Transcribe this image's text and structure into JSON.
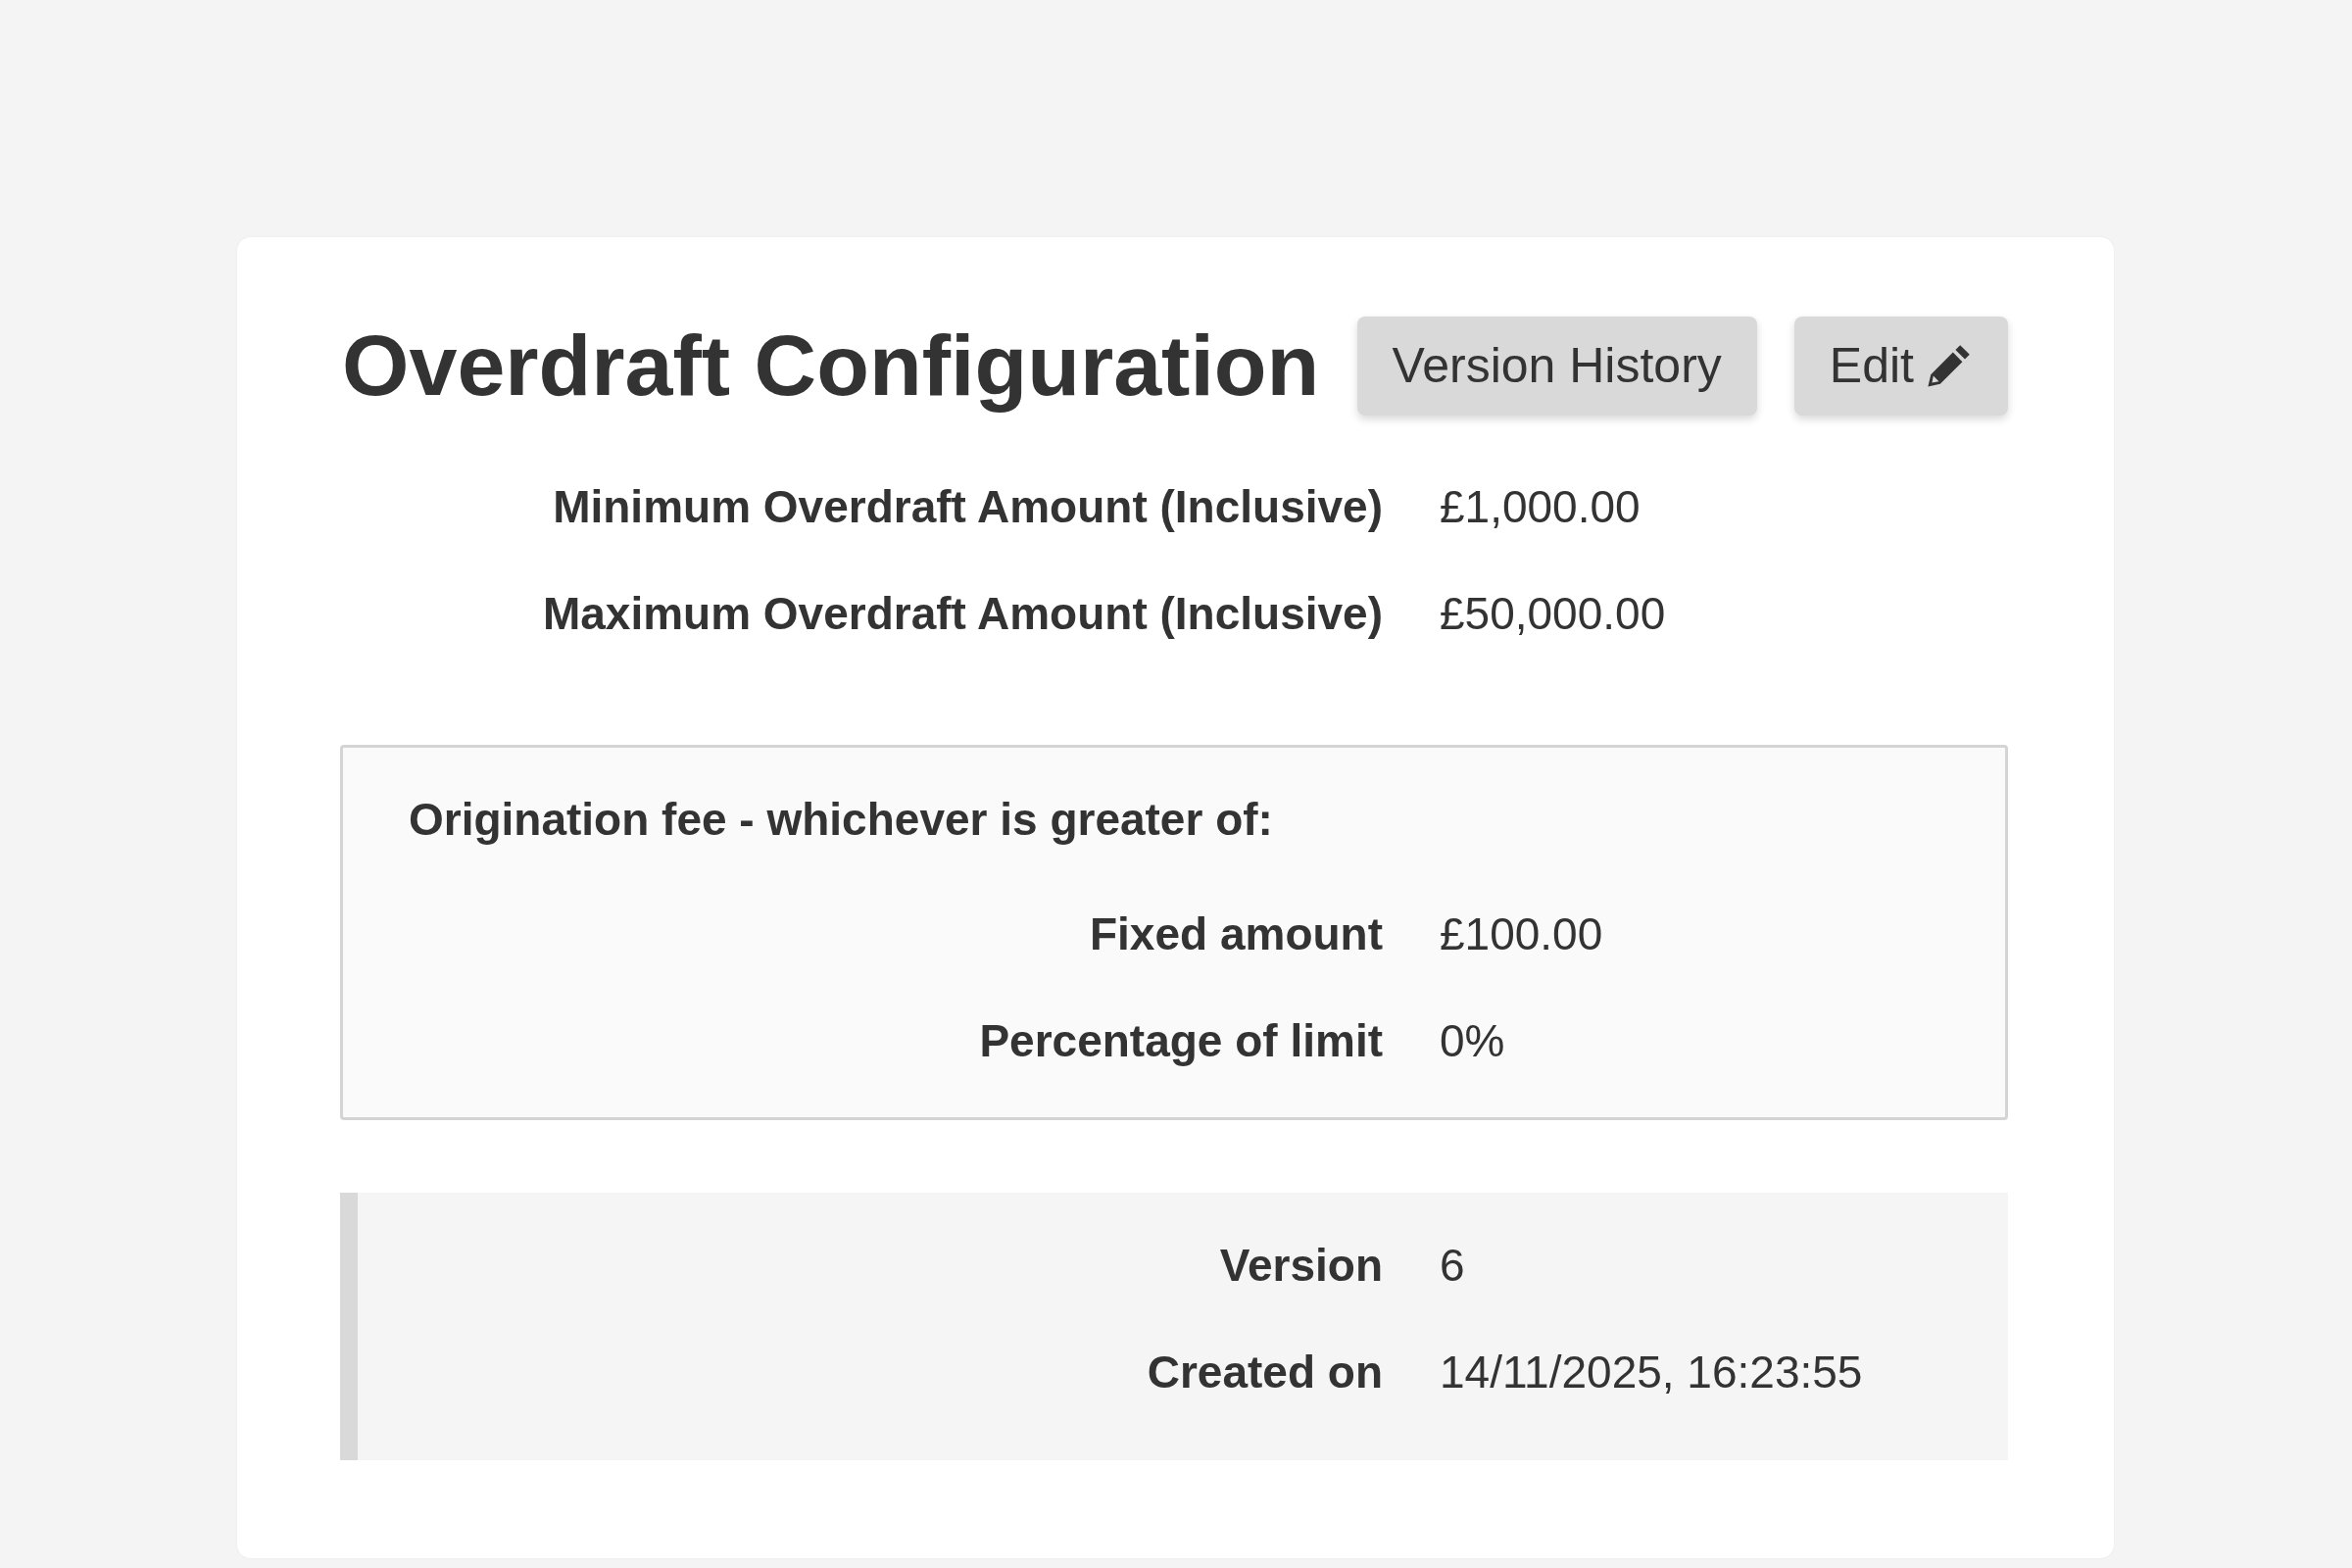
{
  "title": "Overdraft Configuration",
  "buttons": [
    {
      "label": "Version History",
      "kind": "text"
    },
    {
      "label": "Edit",
      "kind": "edit"
    }
  ],
  "limits": [
    {
      "label": "Minimum Overdraft Amount (Inclusive)",
      "value": "£1,000.00"
    },
    {
      "label": "Maximum Overdraft Amount (Inclusive)",
      "value": "£50,000.00"
    }
  ],
  "origination_fee": {
    "heading": "Origination fee - whichever is greater of:",
    "rows": [
      {
        "label": "Fixed amount",
        "value": "£100.00"
      },
      {
        "label": "Percentage of limit",
        "value": "0%"
      }
    ]
  },
  "version_info": [
    {
      "label": "Version",
      "value": "6"
    },
    {
      "label": "Created on",
      "value": "14/11/2025, 16:23:55"
    }
  ]
}
